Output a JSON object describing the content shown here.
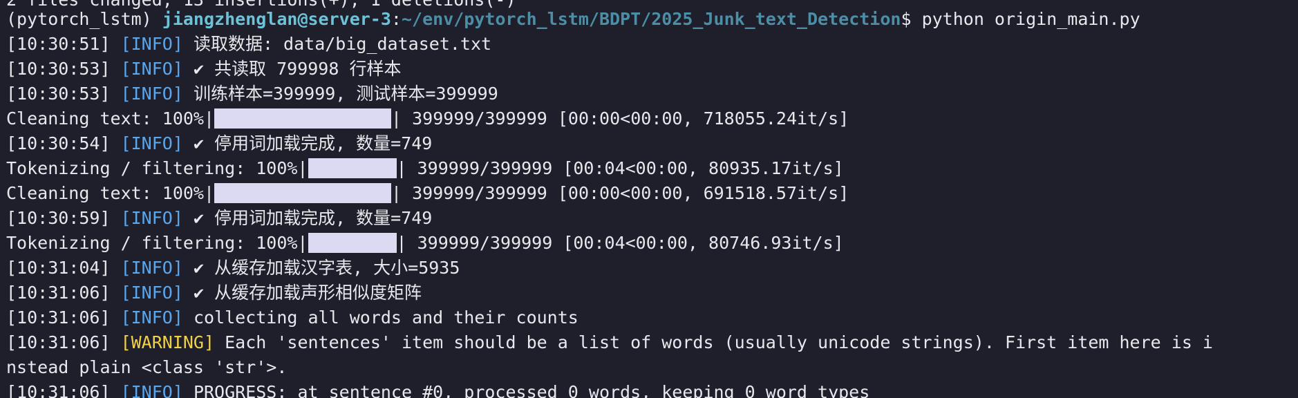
{
  "colors": {
    "background": "#1e1f2b",
    "text": "#e8e8ec",
    "info_tag": "#5aa7ee",
    "warning_tag": "#f1d14a",
    "prompt_user": "#6cc3d8",
    "prompt_path": "#4b8ea6",
    "progress_fill": "#dcdaf2"
  },
  "git_line": "2 files changed, 13 insertions(+), 1 deletions(-)",
  "prompt": {
    "env": "(pytorch_lstm) ",
    "user_host": "jiangzhenglan@server-3",
    "sep": ":",
    "path": "~/env/pytorch_lstm/BDPT/2025_Junk_text_Detection",
    "dollar": "$ ",
    "command": "python origin_main.py"
  },
  "tags": {
    "info": "[INFO]",
    "warning": "[WARNING]"
  },
  "logs": [
    {
      "time": "[10:30:51] ",
      "msg": " 读取数据: data/big_dataset.txt"
    },
    {
      "time": "[10:30:53] ",
      "msg": " ✔ 共读取 799998 行样本"
    },
    {
      "time": "[10:30:53] ",
      "msg": " 训练样本=399999, 测试样本=399999"
    },
    {
      "time": "[10:30:54] ",
      "msg": " ✔ 停用词加载完成, 数量=749"
    },
    {
      "time": "[10:30:59] ",
      "msg": " ✔ 停用词加载完成, 数量=749"
    },
    {
      "time": "[10:31:04] ",
      "msg": " ✔ 从缓存加载汉字表, 大小=5935"
    },
    {
      "time": "[10:31:06] ",
      "msg": " ✔ 从缓存加载声形相似度矩阵"
    },
    {
      "time": "[10:31:06] ",
      "msg": " collecting all words and their counts"
    },
    {
      "time": "[10:31:06] ",
      "msg": " Each 'sentences' item should be a list of words (usually unicode strings). First item here is i"
    },
    {
      "time": "[10:31:06] ",
      "msg": " PROGRESS: at sentence #0, processed 0 words, keeping 0 word types"
    }
  ],
  "warning_wrap": "nstead plain <class 'str'>.",
  "progress": [
    {
      "label": "Cleaning text: 100%|",
      "percent": 100,
      "stats": "| 399999/399999 [00:00<00:00, 718055.24it/s]"
    },
    {
      "label": "Tokenizing / filtering: 100%|",
      "percent": 100,
      "stats": "| 399999/399999 [00:04<00:00, 80935.17it/s]"
    },
    {
      "label": "Cleaning text: 100%|",
      "percent": 100,
      "stats": "| 399999/399999 [00:00<00:00, 691518.57it/s]"
    },
    {
      "label": "Tokenizing / filtering: 100%|",
      "percent": 100,
      "stats": "| 399999/399999 [00:04<00:00, 80746.93it/s]"
    }
  ]
}
